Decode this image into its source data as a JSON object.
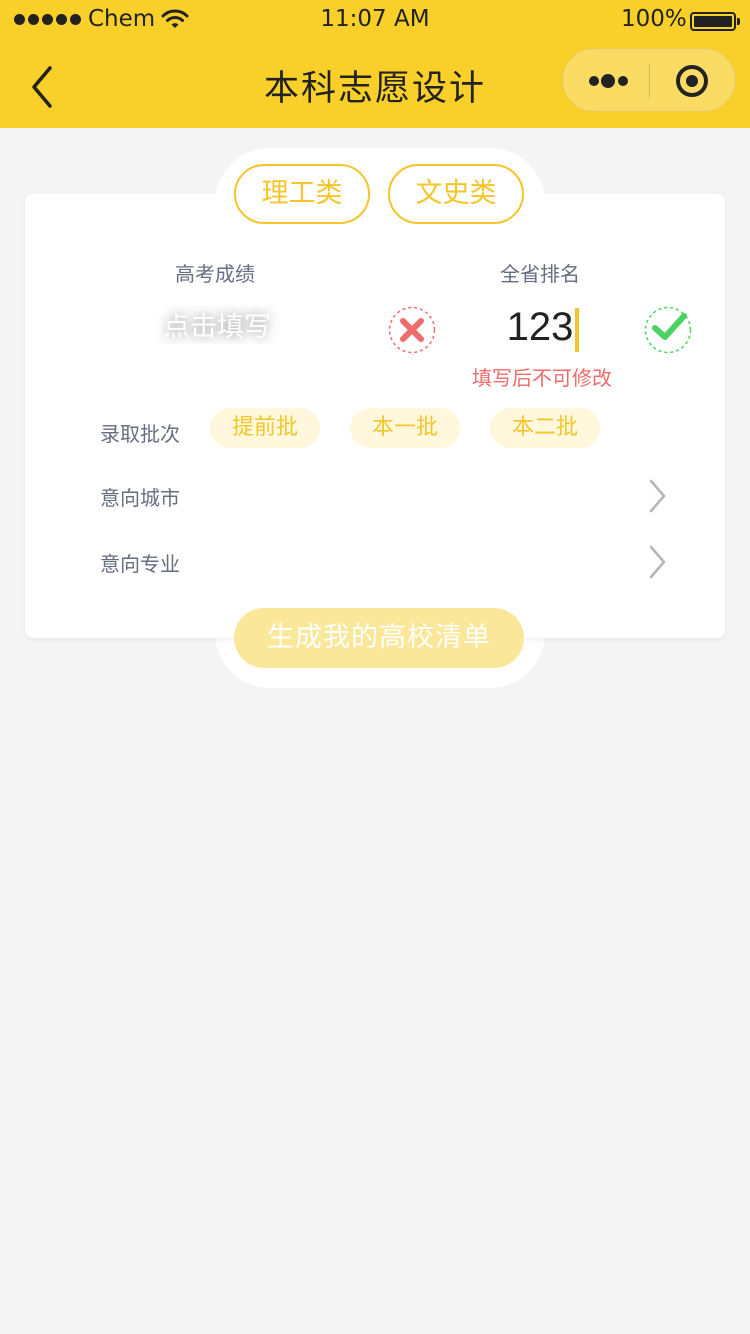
{
  "status_bar": {
    "carrier": "Chem",
    "time": "11:07 AM",
    "battery": "100%"
  },
  "nav": {
    "title": "本科志愿设计",
    "back_icon": "chevron-left-icon",
    "more_icon": "more-dots-icon",
    "close_icon": "target-circle-icon"
  },
  "tabs": [
    {
      "label": "理工类"
    },
    {
      "label": "文史类"
    }
  ],
  "form": {
    "score_label": "高考成绩",
    "score_placeholder": "点击填写",
    "rank_label": "全省排名",
    "rank_value": "123",
    "rank_note": "填写后不可修改",
    "batch_label": "录取批次",
    "batches": [
      {
        "label": "提前批"
      },
      {
        "label": "本一批"
      },
      {
        "label": "本二批"
      }
    ],
    "city_label": "意向城市",
    "major_label": "意向专业"
  },
  "generate_button": "生成我的高校清单",
  "colors": {
    "header": "#f9cf2a",
    "accent": "#f5c52a",
    "error": "#f06b6b",
    "success": "#4cd263",
    "button_disabled": "#fbe799"
  }
}
